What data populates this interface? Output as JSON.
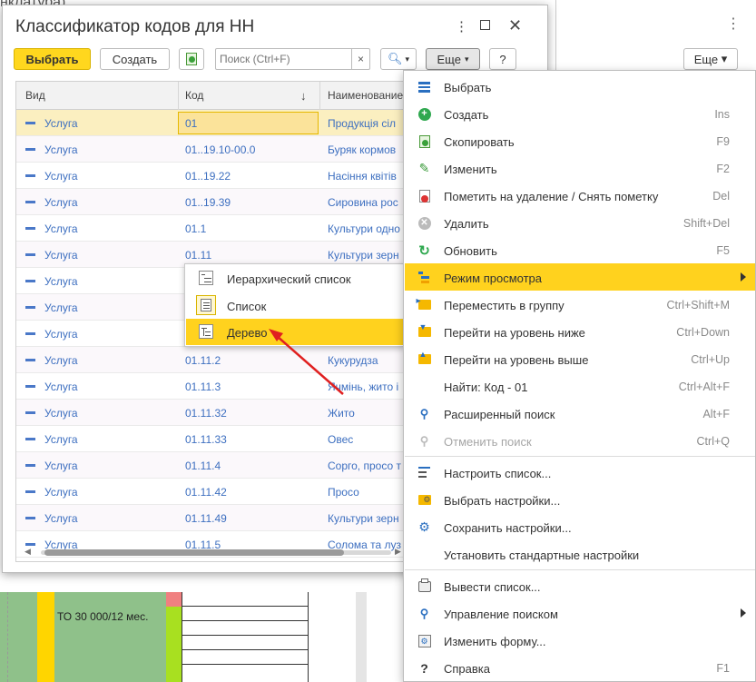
{
  "background": {
    "title_fragment": "нклатура)",
    "more_label": "Еще",
    "cell_text": "ТО 30 000/12 мес."
  },
  "dialog": {
    "title": "Классификатор кодов для НН",
    "toolbar": {
      "select_label": "Выбрать",
      "create_label": "Создать",
      "search_placeholder": "Поиск (Ctrl+F)",
      "clear_label": "×",
      "more_label": "Еще",
      "help_label": "?"
    },
    "columns": [
      "Вид",
      "Код",
      "Наименование"
    ],
    "rows": [
      {
        "kind": "Услуга",
        "code": "01",
        "name": "Продукція сіл"
      },
      {
        "kind": "Услуга",
        "code": "01..19.10-00.0",
        "name": "Буряк кормов"
      },
      {
        "kind": "Услуга",
        "code": "01..19.22",
        "name": "Насіння квітів"
      },
      {
        "kind": "Услуга",
        "code": "01..19.39",
        "name": "Сировина рос"
      },
      {
        "kind": "Услуга",
        "code": "01.1",
        "name": "Культури одно"
      },
      {
        "kind": "Услуга",
        "code": "01.11",
        "name": "Культури зерн"
      },
      {
        "kind": "Услуга",
        "code": "",
        "name": ""
      },
      {
        "kind": "Услуга",
        "code": "",
        "name": ""
      },
      {
        "kind": "Услуга",
        "code": "",
        "name": ""
      },
      {
        "kind": "Услуга",
        "code": "01.11.2",
        "name": "Кукурудза"
      },
      {
        "kind": "Услуга",
        "code": "01.11.3",
        "name": "Ячмінь, жито і"
      },
      {
        "kind": "Услуга",
        "code": "01.11.32",
        "name": "Жито"
      },
      {
        "kind": "Услуга",
        "code": "01.11.33",
        "name": "Овес"
      },
      {
        "kind": "Услуга",
        "code": "01.11.4",
        "name": "Сорго, просо т"
      },
      {
        "kind": "Услуга",
        "code": "01.11.42",
        "name": "Просо"
      },
      {
        "kind": "Услуга",
        "code": "01.11.49",
        "name": "Культури зерн"
      },
      {
        "kind": "Услуга",
        "code": "01.11.5",
        "name": "Солома та луз"
      }
    ]
  },
  "view_submenu": {
    "items": [
      {
        "label": "Иерархический список",
        "icon": "hierarchical-list-icon"
      },
      {
        "label": "Список",
        "icon": "list-icon"
      },
      {
        "label": "Дерево",
        "icon": "tree-icon"
      }
    ]
  },
  "menu": {
    "items": [
      {
        "label": "Выбрать",
        "shortcut": "",
        "icon": "select-icon"
      },
      {
        "label": "Создать",
        "shortcut": "Ins",
        "icon": "create-icon"
      },
      {
        "label": "Скопировать",
        "shortcut": "F9",
        "icon": "copy-icon"
      },
      {
        "label": "Изменить",
        "shortcut": "F2",
        "icon": "edit-icon"
      },
      {
        "label": "Пометить на удаление / Снять пометку",
        "shortcut": "Del",
        "icon": "mark-delete-icon"
      },
      {
        "label": "Удалить",
        "shortcut": "Shift+Del",
        "icon": "delete-icon"
      },
      {
        "label": "Обновить",
        "shortcut": "F5",
        "icon": "refresh-icon"
      },
      {
        "label": "Режим просмотра",
        "shortcut": "",
        "icon": "view-mode-icon"
      },
      {
        "label": "Переместить в группу",
        "shortcut": "Ctrl+Shift+M",
        "icon": "move-to-group-icon"
      },
      {
        "label": "Перейти на уровень ниже",
        "shortcut": "Ctrl+Down",
        "icon": "level-down-icon"
      },
      {
        "label": "Перейти на уровень выше",
        "shortcut": "Ctrl+Up",
        "icon": "level-up-icon"
      },
      {
        "label": "Найти: Код - 01",
        "shortcut": "Ctrl+Alt+F",
        "icon": ""
      },
      {
        "label": "Расширенный поиск",
        "shortcut": "Alt+F",
        "icon": "advanced-search-icon"
      },
      {
        "label": "Отменить поиск",
        "shortcut": "Ctrl+Q",
        "icon": "cancel-search-icon"
      },
      {
        "label": "Настроить список...",
        "shortcut": "",
        "icon": "configure-list-icon"
      },
      {
        "label": "Выбрать настройки...",
        "shortcut": "",
        "icon": "choose-settings-icon"
      },
      {
        "label": "Сохранить настройки...",
        "shortcut": "",
        "icon": "save-settings-icon"
      },
      {
        "label": "Установить стандартные настройки",
        "shortcut": "",
        "icon": ""
      },
      {
        "label": "Вывести список...",
        "shortcut": "",
        "icon": "print-list-icon"
      },
      {
        "label": "Управление поиском",
        "shortcut": "",
        "icon": "search-control-icon"
      },
      {
        "label": "Изменить форму...",
        "shortcut": "",
        "icon": "change-form-icon"
      },
      {
        "label": "Справка",
        "shortcut": "F1",
        "icon": "help-icon"
      }
    ]
  },
  "colors": {
    "accent_yellow": "#ffd21e",
    "link_blue": "#3d6fc0",
    "annotation_red": "#e02020"
  }
}
